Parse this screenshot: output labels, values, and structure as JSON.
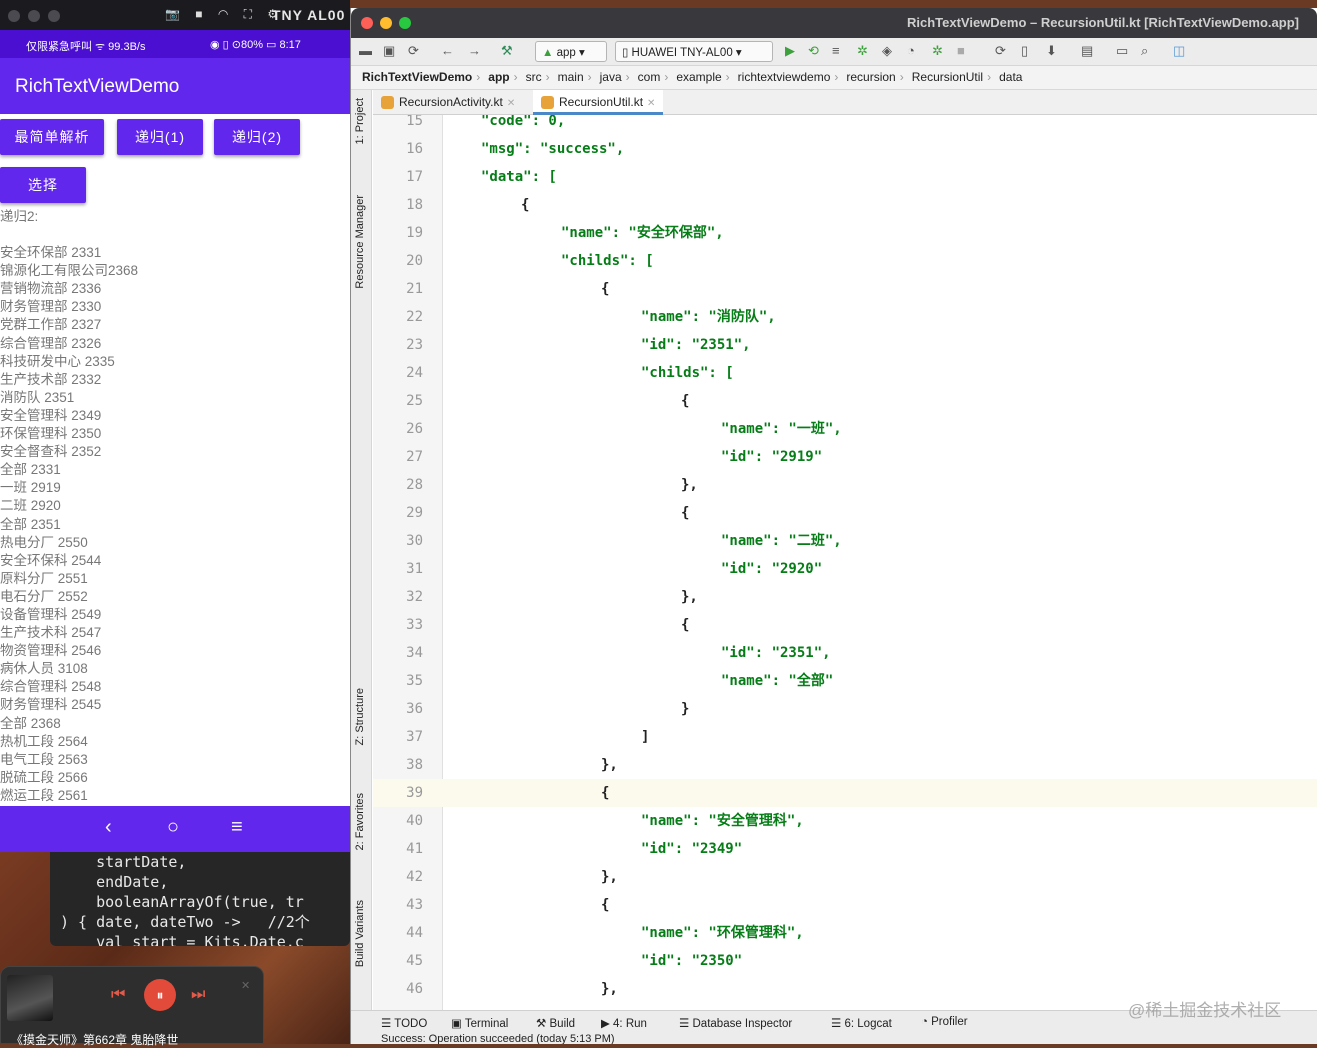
{
  "phone": {
    "device_name": "TNY AL00",
    "mac_icons": "📷 ■ ◠ ⛶ ⚙",
    "status_left": "仅限紧急呼叫 ᯤ 99.3B/s",
    "status_right": "◉ ▯ ⊙80% ▭ 8:17",
    "app_title": "RichTextViewDemo",
    "buttons": [
      "最简单解析",
      "递归(1)",
      "递归(2)"
    ],
    "select_button": "选择",
    "result_label": "递归2:",
    "items": [
      "安全环保部 2331",
      "锦源化工有限公司2368",
      "营销物流部 2336",
      "财务管理部 2330",
      "党群工作部 2327",
      "综合管理部 2326",
      "科技研发中心 2335",
      "生产技术部 2332",
      "消防队 2351",
      "安全管理科 2349",
      "环保管理科 2350",
      "安全督查科 2352",
      "全部 2331",
      "一班 2919",
      "二班 2920",
      "全部 2351",
      "热电分厂 2550",
      "安全环保科 2544",
      "原料分厂 2551",
      "电石分厂 2552",
      "设备管理科 2549",
      "生产技术科 2547",
      "物资管理科 2546",
      "病休人员 3108",
      "综合管理科 2548",
      "财务管理科 2545",
      "全部 2368",
      "热机工段 2564",
      "电气工段 2563",
      "脱硫工段 2566",
      "燃运工段 2561"
    ],
    "nav": {
      "back": "‹",
      "home": "○",
      "menu": "≡"
    }
  },
  "background_code": [
    "    startDate,",
    "    endDate,",
    "    booleanArrayOf(true, tr",
    ") { date, dateTwo ->   //2个",
    "    val start = Kits.Date.c"
  ],
  "player": {
    "title": "《摸金天师》第662章 鬼胎降世",
    "icons": {
      "prev": "⏮",
      "pause": "⏸",
      "next": "⏭",
      "close": "✕"
    }
  },
  "ide": {
    "window_title": "RichTextViewDemo – RecursionUtil.kt [RichTextViewDemo.app]",
    "run_config": "app",
    "device": "HUAWEI TNY-AL00",
    "breadcrumbs": [
      "RichTextViewDemo",
      "app",
      "src",
      "main",
      "java",
      "com",
      "example",
      "richtextviewdemo",
      "recursion",
      "RecursionUtil",
      "data"
    ],
    "tabs": [
      "RecursionActivity.kt",
      "RecursionUtil.kt"
    ],
    "side_tools": [
      "1: Project",
      "Resource Manager",
      "Z: Structure",
      "2: Favorites",
      "Build Variants"
    ],
    "code_lines": [
      {
        "n": "15",
        "indent": 4,
        "text": "\"code\": 0,"
      },
      {
        "n": "16",
        "indent": 4,
        "text": "\"msg\": \"success\","
      },
      {
        "n": "17",
        "indent": 4,
        "text": "\"data\": ["
      },
      {
        "n": "18",
        "indent": 8,
        "text": "{"
      },
      {
        "n": "19",
        "indent": 12,
        "text": "\"name\": \"安全环保部\","
      },
      {
        "n": "20",
        "indent": 12,
        "text": "\"childs\": ["
      },
      {
        "n": "21",
        "indent": 16,
        "text": "{"
      },
      {
        "n": "22",
        "indent": 20,
        "text": "\"name\": \"消防队\","
      },
      {
        "n": "23",
        "indent": 20,
        "text": "\"id\": \"2351\","
      },
      {
        "n": "24",
        "indent": 20,
        "text": "\"childs\": ["
      },
      {
        "n": "25",
        "indent": 24,
        "text": "{"
      },
      {
        "n": "26",
        "indent": 28,
        "text": "\"name\": \"一班\","
      },
      {
        "n": "27",
        "indent": 28,
        "text": "\"id\": \"2919\""
      },
      {
        "n": "28",
        "indent": 24,
        "text": "},"
      },
      {
        "n": "29",
        "indent": 24,
        "text": "{"
      },
      {
        "n": "30",
        "indent": 28,
        "text": "\"name\": \"二班\","
      },
      {
        "n": "31",
        "indent": 28,
        "text": "\"id\": \"2920\""
      },
      {
        "n": "32",
        "indent": 24,
        "text": "},"
      },
      {
        "n": "33",
        "indent": 24,
        "text": "{"
      },
      {
        "n": "34",
        "indent": 28,
        "text": "\"id\": \"2351\","
      },
      {
        "n": "35",
        "indent": 28,
        "text": "\"name\": \"全部\""
      },
      {
        "n": "36",
        "indent": 24,
        "text": "}"
      },
      {
        "n": "37",
        "indent": 20,
        "text": "]"
      },
      {
        "n": "38",
        "indent": 16,
        "text": "},"
      },
      {
        "n": "39",
        "indent": 16,
        "text": "{"
      },
      {
        "n": "40",
        "indent": 20,
        "text": "\"name\": \"安全管理科\","
      },
      {
        "n": "41",
        "indent": 20,
        "text": "\"id\": \"2349\""
      },
      {
        "n": "42",
        "indent": 16,
        "text": "},"
      },
      {
        "n": "43",
        "indent": 16,
        "text": "{"
      },
      {
        "n": "44",
        "indent": 20,
        "text": "\"name\": \"环保管理科\","
      },
      {
        "n": "45",
        "indent": 20,
        "text": "\"id\": \"2350\""
      },
      {
        "n": "46",
        "indent": 16,
        "text": "},"
      }
    ],
    "highlight_line": "39",
    "bottom_tools": [
      "☰ TODO",
      "▣ Terminal",
      "⚒ Build",
      "▶ 4: Run",
      "☰ Database Inspector",
      "☰ 6: Logcat",
      "◔ Profiler"
    ],
    "status": "Success: Operation succeeded (today 5:13 PM)"
  },
  "watermark": "@稀土掘金技术社区"
}
